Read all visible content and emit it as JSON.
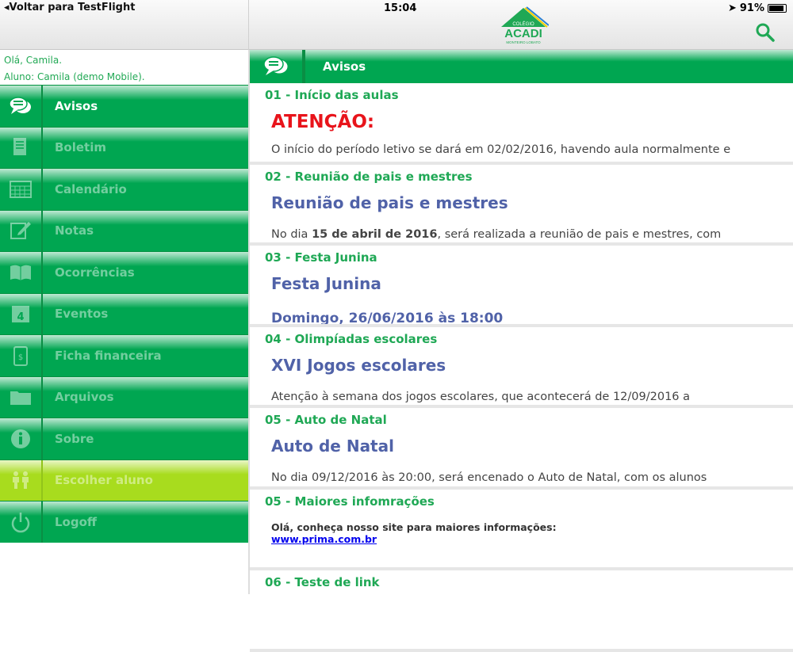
{
  "status": {
    "back": "Voltar para TestFlight",
    "time": "15:04",
    "battery": "91%",
    "battery_level": 0.91
  },
  "logo": {
    "top": "COLÉGIO",
    "name": "ACADI",
    "sub": "MONTEIRO LOBATO"
  },
  "greeting": {
    "hello": "Olá, Camila.",
    "student": "Aluno: Camila (demo Mobile)."
  },
  "menu": [
    {
      "label": "Avisos",
      "icon": "chat-bubbles-icon"
    },
    {
      "label": "Boletim",
      "icon": "document-icon"
    },
    {
      "label": "Calendário",
      "icon": "calendar-grid-icon"
    },
    {
      "label": "Notas",
      "icon": "pencil-note-icon"
    },
    {
      "label": "Ocorrências",
      "icon": "open-book-icon"
    },
    {
      "label": "Eventos",
      "icon": "calendar-day-icon"
    },
    {
      "label": "Ficha financeira",
      "icon": "money-clipboard-icon"
    },
    {
      "label": "Arquivos",
      "icon": "folder-icon"
    },
    {
      "label": "Sobre",
      "icon": "info-icon"
    },
    {
      "label": "Escolher aluno",
      "icon": "children-icon"
    },
    {
      "label": "Logoff",
      "icon": "power-icon"
    }
  ],
  "header": {
    "title": "Avisos"
  },
  "notices": [
    {
      "title": "01 - Início das aulas",
      "heading": "ATENÇÃO:",
      "body": "O início do período letivo se dará em 02/02/2016, havendo aula normalmente e"
    },
    {
      "title": "02 - Reunião de pais e mestres",
      "heading": "Reunião de pais e mestres",
      "body_pre": "No dia ",
      "body_bold": "15 de abril de 2016",
      "body_post": ", será realizada a reunião de pais e mestres, com"
    },
    {
      "title": "03 - Festa Junina",
      "heading": "Festa Junina",
      "sub": "Domingo, 26/06/2016 às 18:00"
    },
    {
      "title": "04 - Olimpíadas escolares",
      "heading": "XVI Jogos escolares",
      "body": "Atenção à semana dos jogos escolares, que acontecerá de 12/09/2016 a"
    },
    {
      "title": "05 - Auto de Natal",
      "heading": "Auto de Natal",
      "body": "No dia 09/12/2016 às 20:00, será encenado o Auto de Natal, com os alunos"
    },
    {
      "title": "05 - Maiores infomrações",
      "body": "Olá, conheça nosso site para maiores informações:",
      "link": "www.prima.com.br"
    },
    {
      "title": "06 - Teste de link"
    }
  ],
  "colors": {
    "green": "#00a651",
    "lime": "#a8dc1e",
    "red": "#e8141b",
    "blue": "#5062a8"
  }
}
